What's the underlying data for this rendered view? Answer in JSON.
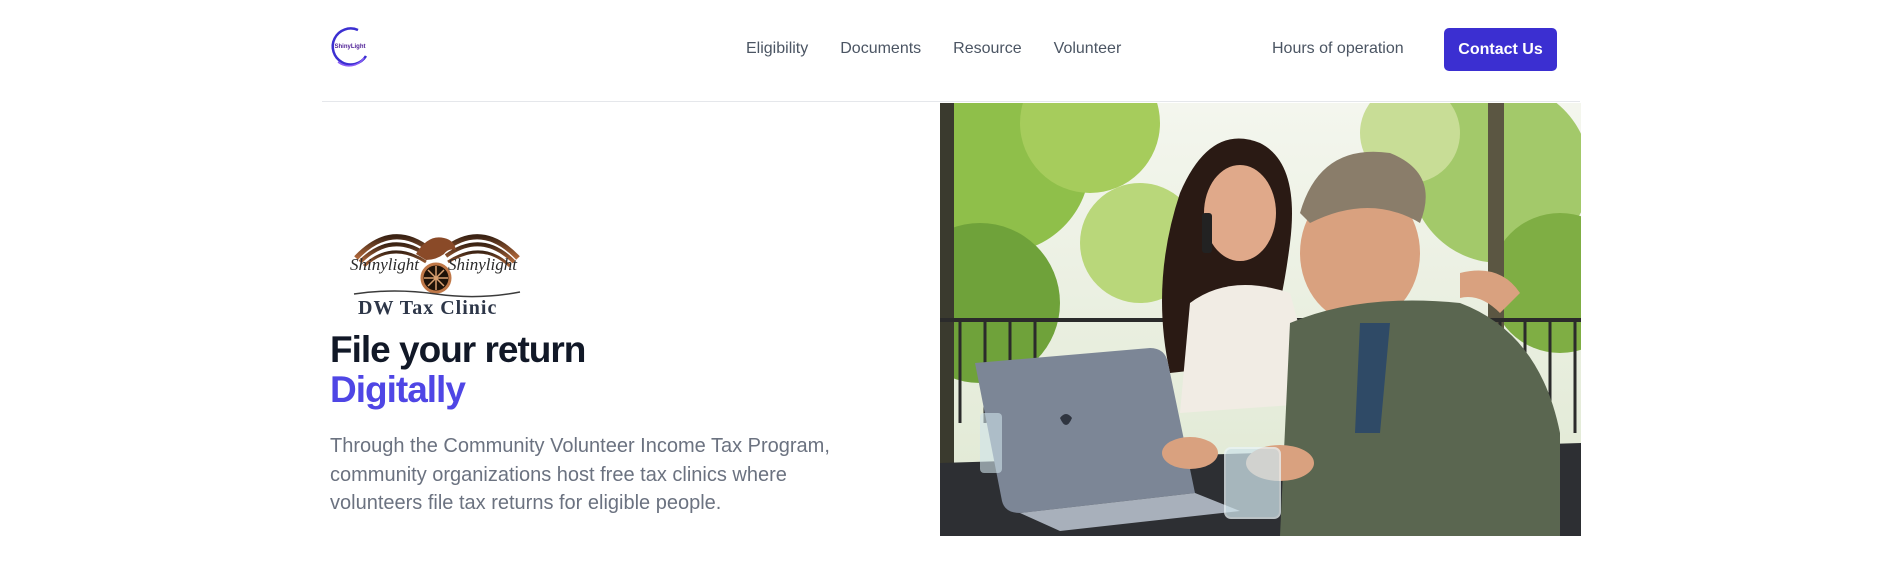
{
  "header": {
    "logo_alt_text": "ShinyLight",
    "nav": [
      {
        "label": "Eligibility"
      },
      {
        "label": "Documents"
      },
      {
        "label": "Resource"
      },
      {
        "label": "Volunteer"
      }
    ],
    "hours_label": "Hours of operation",
    "contact_label": "Contact Us"
  },
  "hero": {
    "logo_text": "DW Tax Clinic",
    "logo_brand": "Shinylight",
    "headline_line1": "File your return",
    "headline_line2": "Digitally",
    "description": "Through the Community Volunteer Income Tax Program, community organizations host free tax clinics where volunteers file tax returns for eligible people."
  },
  "colors": {
    "accent": "#4f46e5",
    "button": "#3b2fd1",
    "heading": "#111827",
    "body_text": "#6b7280"
  }
}
